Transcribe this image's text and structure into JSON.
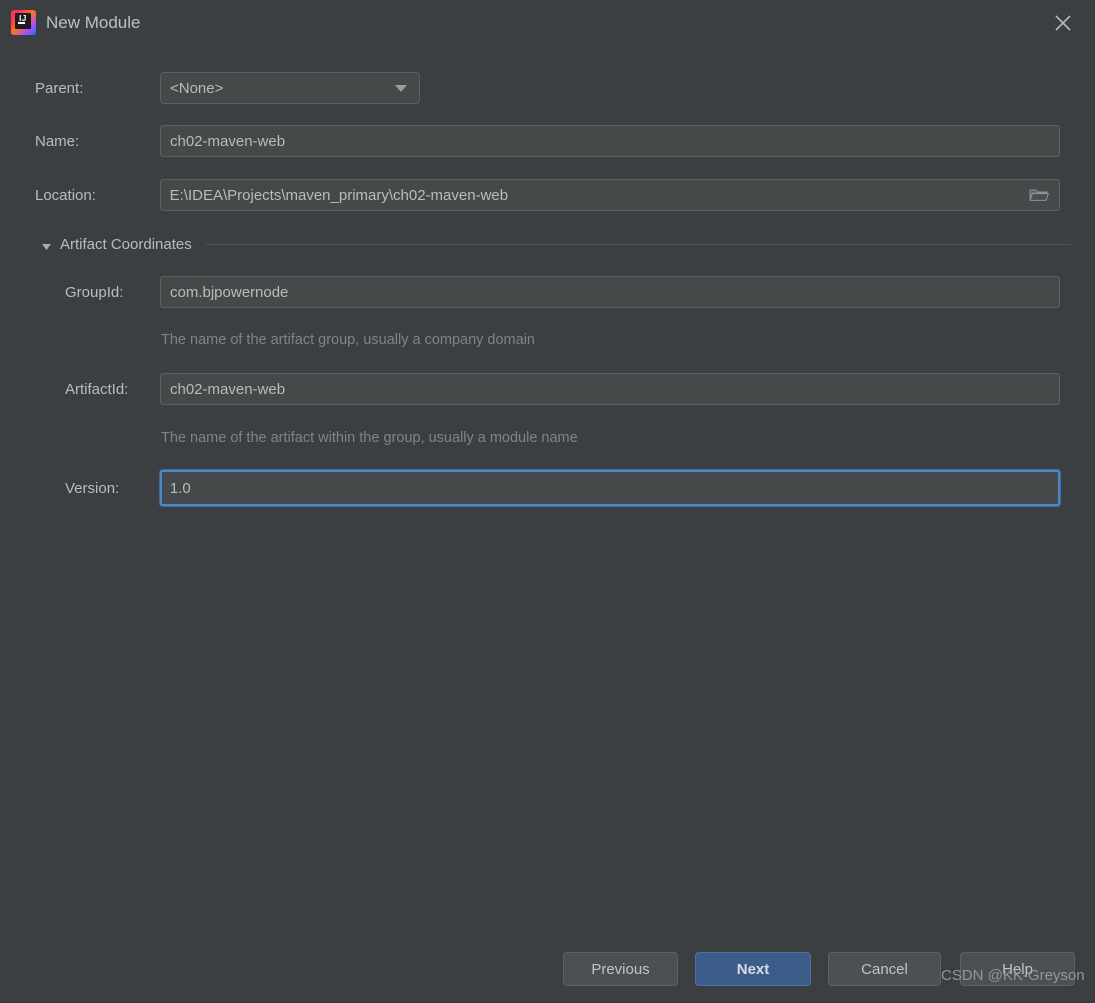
{
  "window": {
    "title": "New Module",
    "logo_text": "IJ",
    "close_icon": "close-icon"
  },
  "form": {
    "parent": {
      "label": "Parent:",
      "value": "<None>",
      "arrow_icon": "chevron-down-icon"
    },
    "name": {
      "label": "Name:",
      "value": "ch02-maven-web"
    },
    "location": {
      "label": "Location:",
      "value": "E:\\IDEA\\Projects\\maven_primary\\ch02-maven-web",
      "browse_icon": "folder-icon"
    }
  },
  "artifact_section": {
    "title": "Artifact Coordinates",
    "expanded": true,
    "toggle_icon": "triangle-down-icon",
    "group_id": {
      "label": "GroupId:",
      "value": "com.bjpowernode",
      "hint": "The name of the artifact group, usually a company domain"
    },
    "artifact_id": {
      "label": "ArtifactId:",
      "value": "ch02-maven-web",
      "hint": "The name of the artifact within the group, usually a module name"
    },
    "version": {
      "label": "Version:",
      "value": "1.0",
      "focused": true
    }
  },
  "buttons": {
    "previous": "Previous",
    "next": "Next",
    "cancel": "Cancel",
    "help": "Help"
  },
  "watermark": "CSDN @KK-Greyson",
  "colors": {
    "dialog_bg": "#3c3f41",
    "field_bg": "#45494a",
    "focus_border": "#4a88c7",
    "primary_button": "#3c5d8a",
    "text": "#bbbbbb",
    "hint_text": "#808387"
  }
}
